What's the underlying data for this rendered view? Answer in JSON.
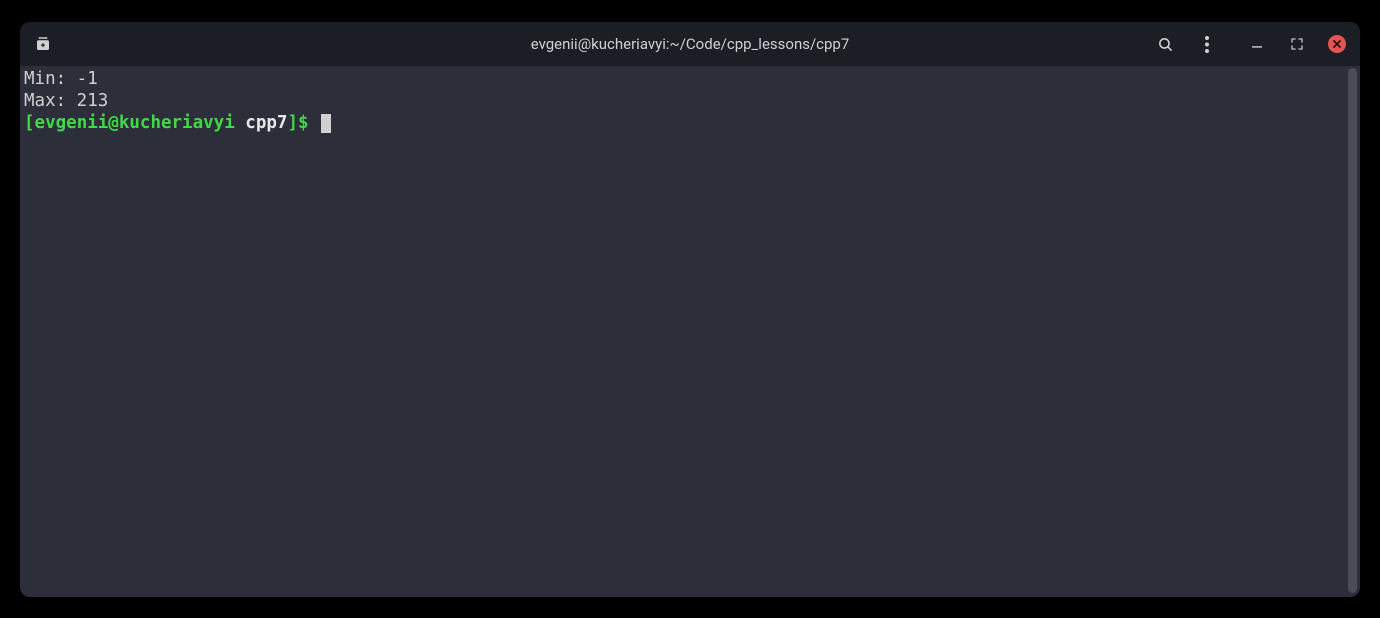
{
  "titlebar": {
    "title": "evgenii@kucheriavyi:~/Code/cpp_lessons/cpp7"
  },
  "output": {
    "line1": "Min: -1",
    "line2": "Max: 213"
  },
  "prompt": {
    "open_bracket": "[",
    "userhost": "evgenii@kucheriavyi",
    "space": " ",
    "dir": "cpp7",
    "close": "]$ "
  }
}
